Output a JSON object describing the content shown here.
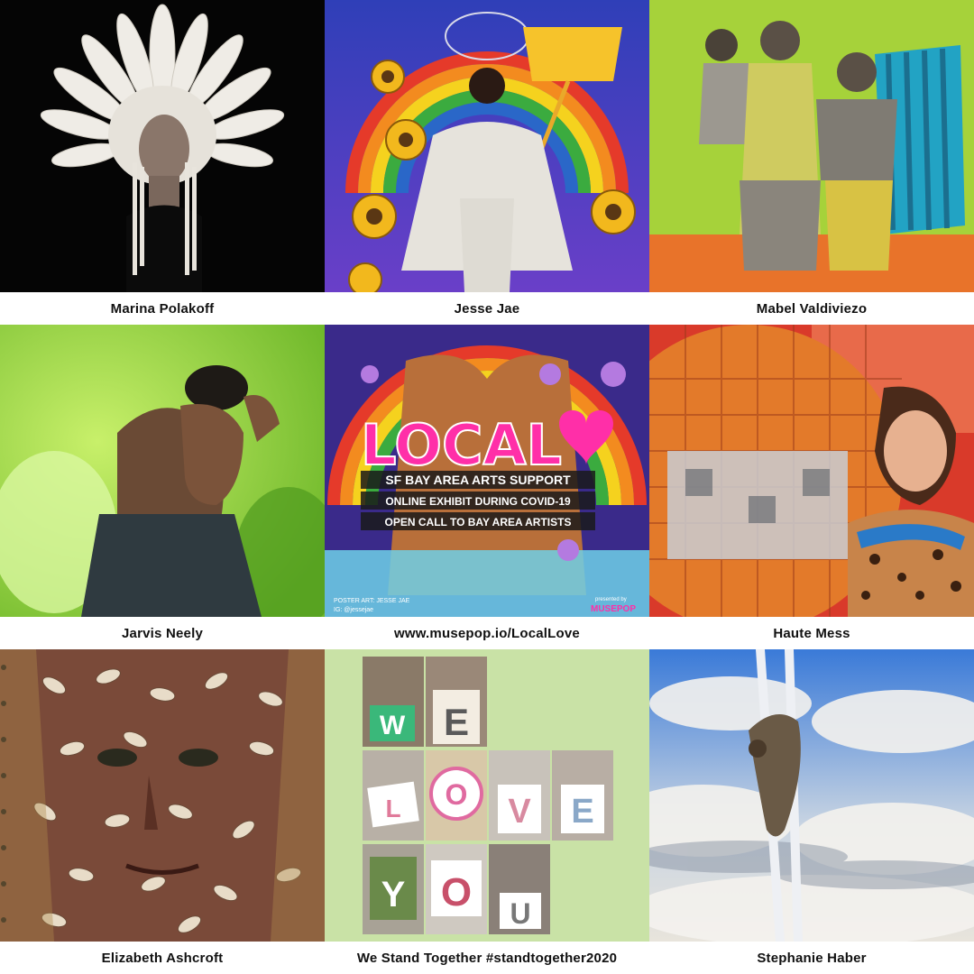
{
  "tiles": [
    {
      "caption": "Marina Polakoff"
    },
    {
      "caption": "Jesse Jae"
    },
    {
      "caption": "Mabel Valdiviezo"
    },
    {
      "caption": "Jarvis Neely"
    },
    {
      "caption": "www.musepop.io/LocalLove"
    },
    {
      "caption": "Haute Mess"
    },
    {
      "caption": "Elizabeth Ashcroft"
    },
    {
      "caption": "We Stand Together #standtogether2020"
    },
    {
      "caption": "Stephanie Haber"
    }
  ],
  "poster": {
    "title": "LOCAL",
    "line1": "SF BAY AREA ARTS SUPPORT",
    "line2": "ONLINE EXHIBIT DURING COVID-19",
    "line3": "OPEN CALL TO BAY AREA ARTISTS",
    "credit1": "POSTER ART: JESSE JAE",
    "credit2": "IG: @jessejae",
    "presented": "presented by",
    "brand": "MUSEPOP"
  },
  "letters": {
    "w": "W",
    "e": "E",
    "l": "L",
    "o": "O",
    "v": "V",
    "e2": "E",
    "y": "Y",
    "o2": "O",
    "u": "U"
  },
  "colors": {
    "poster_pink": "#ff2fa8",
    "caption_text": "#111111",
    "lime_bg": "#c9e2a6"
  }
}
